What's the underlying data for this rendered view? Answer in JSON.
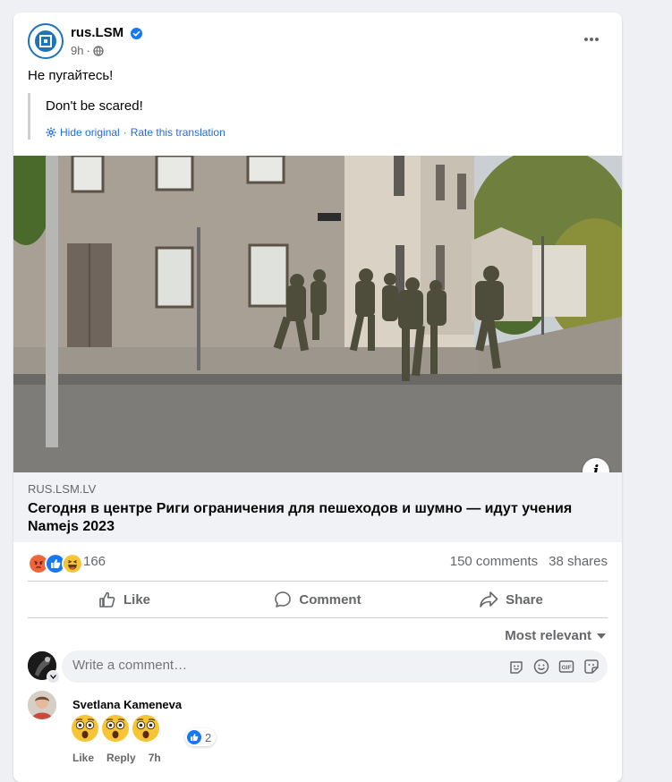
{
  "post": {
    "page_name": "rus.LSM",
    "time": "9h",
    "privacy_icon": "globe-icon",
    "more_icon": "more-horizontal-icon",
    "text": "Не пугайтесь!",
    "translation": {
      "text": "Don't be scared!",
      "hide_original": "Hide original",
      "separator": "·",
      "rate": "Rate this translation"
    }
  },
  "link": {
    "domain": "RUS.LSM.LV",
    "title": "Сегодня в центре Риги ограничения для пешеходов и шумно — идут учения Namejs 2023",
    "info_icon": "i"
  },
  "stats": {
    "reaction_count": "166",
    "comments": "150 comments",
    "shares": "38 shares",
    "reaction_icons": [
      "angry-icon",
      "like-icon",
      "haha-icon"
    ]
  },
  "actions": {
    "like": "Like",
    "comment": "Comment",
    "share": "Share"
  },
  "sort": {
    "label": "Most relevant"
  },
  "composer": {
    "placeholder": "Write a comment…",
    "icons": [
      "sticker-icon",
      "emoji-icon",
      "gif-icon",
      "sticker-smile-icon"
    ]
  },
  "comments": [
    {
      "author": "Svetlana Kameneva",
      "emojis": [
        "astonished-face",
        "astonished-face",
        "astonished-face"
      ],
      "reaction_count": "2",
      "like": "Like",
      "reply": "Reply",
      "time": "7h"
    }
  ],
  "colors": {
    "accent": "#1877f2",
    "link": "#216fdb",
    "secondary_text": "#65676b",
    "page_bg": "#eef0f3"
  }
}
